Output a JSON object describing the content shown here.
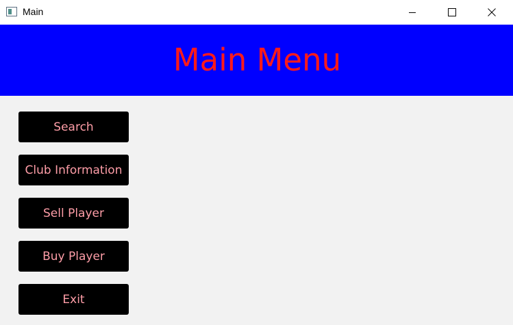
{
  "window": {
    "title": "Main",
    "icon": "app-window-icon",
    "controls": [
      "minimize-icon",
      "maximize-icon",
      "close-icon"
    ]
  },
  "header": {
    "title": "Main Menu",
    "background_color": "#0000ff",
    "text_color": "#ff1a1a"
  },
  "menu": {
    "button_color": "#000000",
    "text_color": "#ff9ea8",
    "items": [
      {
        "label": "Search"
      },
      {
        "label": "Club Information"
      },
      {
        "label": "Sell Player"
      },
      {
        "label": "Buy Player"
      },
      {
        "label": "Exit"
      }
    ]
  }
}
